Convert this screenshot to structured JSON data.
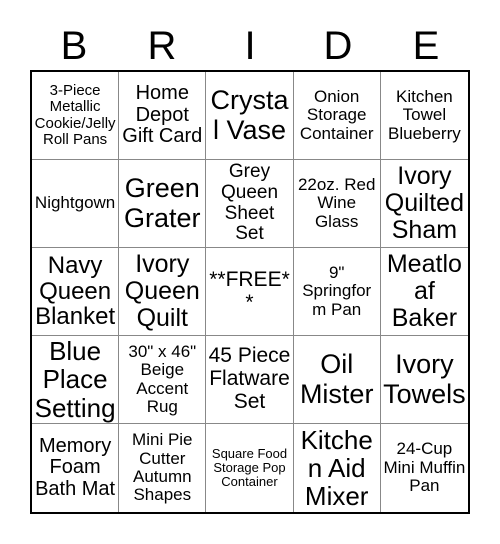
{
  "header": {
    "letters": [
      "B",
      "R",
      "I",
      "D",
      "E"
    ]
  },
  "grid": {
    "rows": 5,
    "columns": 5,
    "free_space_index": 12,
    "cells": [
      {
        "text": "3-Piece Metallic Cookie/Jelly Roll Pans",
        "size": "fs-sm"
      },
      {
        "text": "Home Depot Gift Card",
        "size": "fs-lg"
      },
      {
        "text": "Crystal Vase",
        "size": "fs-xxl"
      },
      {
        "text": "Onion Storage Container",
        "size": "fs-md"
      },
      {
        "text": "Kitchen Towel Blueberry",
        "size": "fs-md"
      },
      {
        "text": "Nightgown",
        "size": "fs-md"
      },
      {
        "text": "Green Grater",
        "size": "fs-xxl"
      },
      {
        "text": "Grey Queen Sheet Set",
        "size": "fs-lg"
      },
      {
        "text": "22oz. Red Wine Glass",
        "size": "fs-md"
      },
      {
        "text": "Ivory Quilted Sham",
        "size": "fs-xl"
      },
      {
        "text": "Navy Queen Blanket",
        "size": "fs-xl"
      },
      {
        "text": "Ivory Queen Quilt",
        "size": "fs-xl"
      },
      {
        "text": "**FREE**",
        "size": "fs-lg"
      },
      {
        "text": "9\" Springform Pan",
        "size": "fs-md"
      },
      {
        "text": "Meatloaf Baker",
        "size": "fs-xl"
      },
      {
        "text": "Blue Place Setting",
        "size": "fs-xxl"
      },
      {
        "text": "30\" x 46\" Beige Accent Rug",
        "size": "fs-md"
      },
      {
        "text": "45 Piece Flatware Set",
        "size": "fs-xl"
      },
      {
        "text": "Oil Mister",
        "size": "fs-xxl"
      },
      {
        "text": "Ivory Towels",
        "size": "fs-xxl"
      },
      {
        "text": "Memory Foam Bath Mat",
        "size": "fs-lg"
      },
      {
        "text": "Mini Pie Cutter Autumn Shapes",
        "size": "fs-md"
      },
      {
        "text": "Square Food Storage Pop Container",
        "size": "fs-xs"
      },
      {
        "text": "Kitchen Aid Mixer",
        "size": "fs-xxl"
      },
      {
        "text": "24-Cup Mini Muffin Pan",
        "size": "fs-md"
      }
    ]
  },
  "colors": {
    "background": "#ffffff",
    "text": "#000000",
    "outer_border": "#000000",
    "inner_border": "#888888"
  }
}
